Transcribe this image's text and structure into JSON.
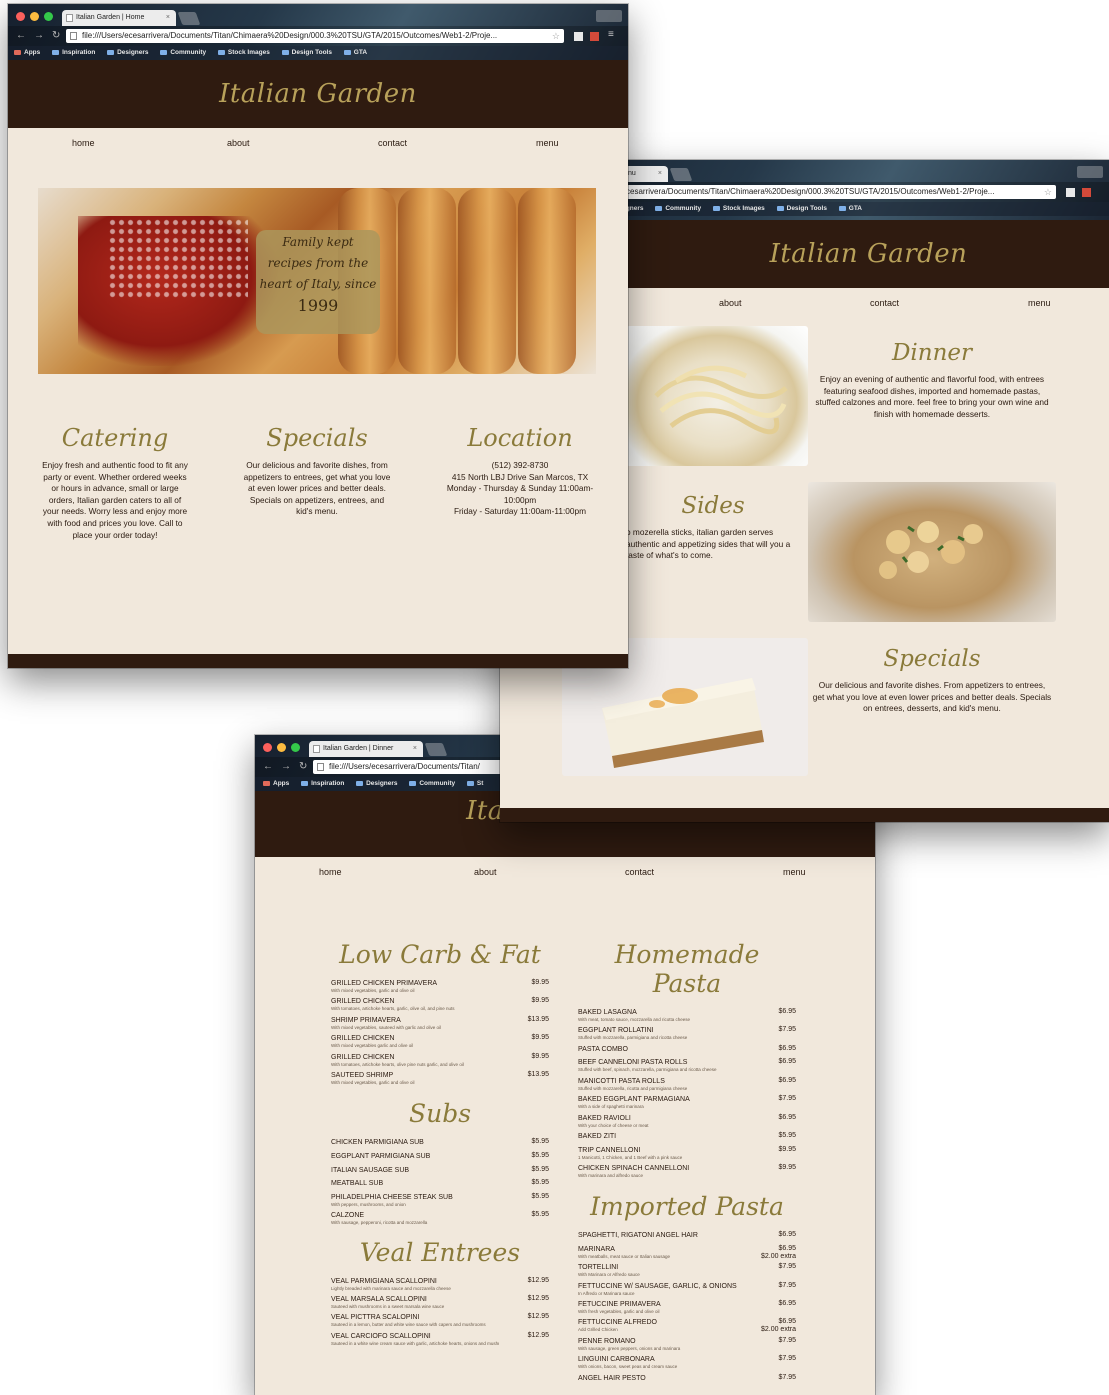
{
  "brand": {
    "logo": "Italian Garden",
    "header_bg": "#2f1b10",
    "accent": "#8a7a3a",
    "page_bg": "#f1e8dc"
  },
  "nav": {
    "home": "home",
    "about": "about",
    "contact": "contact",
    "menu": "menu"
  },
  "bookmarks": [
    "Apps",
    "Inspiration",
    "Designers",
    "Community",
    "Stock Images",
    "Design Tools",
    "GTA"
  ],
  "home_window": {
    "tab_title": "Italian Garden | Home",
    "url": "file:///Users/ecesarrivera/Documents/Titan/Chimaera%20Design/000.3%20TSU/GTA/2015/Outcomes/Web1-2/Proje...",
    "hero_badge": [
      "Family kept",
      "recipes from the",
      "heart of Italy, since",
      "1999"
    ],
    "catering": {
      "title": "Catering",
      "text": "Enjoy fresh and authentic food to fit any party or event. Whether ordered weeks or hours in advance, small or large orders, Italian garden caters to all of your needs. Worry less and enjoy more with food and prices you love. Call to place your order today!"
    },
    "specials": {
      "title": "Specials",
      "text": "Our delicious and favorite dishes, from appetizers to entrees, get what you love at even lower prices and better deals. Specials on appetizers, entrees, and kid's menu."
    },
    "location": {
      "title": "Location",
      "phone": "(512) 392-8730",
      "address": "415 North LBJ Drive San Marcos, TX",
      "hours1": "Monday - Thursday & Sunday 11:00am-10:00pm",
      "hours2": "Friday - Saturday 11:00am-11:00pm"
    }
  },
  "dinner_window": {
    "tab_title": "nu",
    "url": "cesarrivera/Documents/Titan/Chimaera%20Design/000.3%20TSU/GTA/2015/Outcomes/Web1-2/Proje...",
    "bookmarks": [
      "igners",
      "Community",
      "Stock Images",
      "Design Tools",
      "GTA"
    ],
    "dinner": {
      "title": "Dinner",
      "text": "Enjoy an evening of authentic and flavorful food, with entrees featuring seafood dishes, imported and homemade pastas, stuffed calzones and more. feel free to bring your own wine and finish with homemade desserts."
    },
    "sides": {
      "title": "Sides",
      "text": "o mozerella sticks, italian garden serves authentic and appetizing sides that will you a taste of what's to come."
    },
    "specials": {
      "title": "Specials",
      "text": "Our delicious and favorite dishes. From appetizers to entrees, get what you love at even lower prices and better deals. Specials on entrees, desserts, and kid's menu."
    }
  },
  "menu_window": {
    "tab_title": "Italian Garden | Dinner",
    "url": "file:///Users/ecesarrivera/Documents/Titan/",
    "bookmarks": [
      "Apps",
      "Inspiration",
      "Designers",
      "Community",
      "St"
    ],
    "low_carb": {
      "title": "Low Carb & Fat",
      "items": [
        {
          "name": "Grilled Chicken Primavera",
          "desc": "With mixed vegetables, garlic and olive oil",
          "price": "$9.95"
        },
        {
          "name": "Grilled Chicken",
          "desc": "With tomatoes, artichoke hearts, garlic, olive oil, and pine nuts",
          "price": "$9.95"
        },
        {
          "name": "Shrimp Primavera",
          "desc": "With mixed vegetables, sauteed with garlic and olive oil",
          "price": "$13.95"
        },
        {
          "name": "Grilled Chicken",
          "desc": "With mixed vegetables garlic and olive oil",
          "price": "$9.95"
        },
        {
          "name": "Grilled Chicken",
          "desc": "With tomatoes, artichoke hearts, olive pine nuts garlic, and olive oil",
          "price": "$9.95"
        },
        {
          "name": "Sauteed Shrimp",
          "desc": "With mixed vegetables, garlic and olive oil",
          "price": "$13.95"
        }
      ]
    },
    "subs": {
      "title": "Subs",
      "items": [
        {
          "name": "Chicken Parmigiana Sub",
          "desc": "",
          "price": "$5.95"
        },
        {
          "name": "Eggplant Parmigiana Sub",
          "desc": "",
          "price": "$5.95"
        },
        {
          "name": "Italian Sausage Sub",
          "desc": "",
          "price": "$5.95"
        },
        {
          "name": "Meatball Sub",
          "desc": "",
          "price": "$5.95"
        },
        {
          "name": "Philadelphia Cheese Steak Sub",
          "desc": "With peppers, mushrooms, and onion",
          "price": "$5.95"
        },
        {
          "name": "Calzone",
          "desc": "With sausage, pepperoni, ricotta and mozzarella",
          "price": "$5.95"
        }
      ]
    },
    "veal": {
      "title": "Veal Entrees",
      "items": [
        {
          "name": "Veal Parmigiana Scallopini",
          "desc": "Lightly breaded with marinara sauce and mozzarella cheese",
          "price": "$12.95"
        },
        {
          "name": "Veal Marsala Scallopini",
          "desc": "Sauteed with mushrooms in a sweet marsala wine sauce",
          "price": "$12.95"
        },
        {
          "name": "Veal Picttra Scalopini",
          "desc": "Sauteed in a lemon, butter and white wine sauce with capers and mushrooms",
          "price": "$12.95"
        },
        {
          "name": "Veal Carciofo Scallopini",
          "desc": "Sauteed in a white wine cream sauce with garlic, artichoke hearts, onions and mushroom",
          "price": "$12.95"
        }
      ]
    },
    "homemade": {
      "title": "Homemade Pasta",
      "items": [
        {
          "name": "Baked Lasagna",
          "desc": "With meat, tomato sauce, mozzarella and ricotta cheese",
          "price": "$6.95"
        },
        {
          "name": "Eggplant Rollatini",
          "desc": "Stuffed with mozzarella, parmigiana and ricotta cheese",
          "price": "$7.95"
        },
        {
          "name": "Pasta Combo",
          "desc": "",
          "price": "$6.95"
        },
        {
          "name": "Beef Canneloni Pasta Rolls",
          "desc": "Stuffed with beef, spinach, mozzarella, parmigiana and ricotta cheese",
          "price": "$6.95"
        },
        {
          "name": "Manicotti Pasta Rolls",
          "desc": "Stuffed with mozzarella, ricotta and parmigiana cheese",
          "price": "$6.95"
        },
        {
          "name": "Baked Eggplant Parmagiana",
          "desc": "With a side of spaghetti marinara",
          "price": "$7.95"
        },
        {
          "name": "Baked Ravioli",
          "desc": "With your choice of cheese or meat",
          "price": "$6.95"
        },
        {
          "name": "Baked Ziti",
          "desc": "",
          "price": "$5.95"
        },
        {
          "name": "Trip Cannelloni",
          "desc": "1 Manicotti, 1 Chicken, and 1 Beef with a pink sauce",
          "price": "$9.95"
        },
        {
          "name": "Chicken Spinach Cannelloni",
          "desc": "With marinara and alfredo sauce",
          "price": "$9.95"
        }
      ]
    },
    "imported": {
      "title": "Imported Pasta",
      "items": [
        {
          "name": "Spaghetti, Rigatoni Angel Hair",
          "desc": "",
          "price": "$6.95",
          "extra": ""
        },
        {
          "name": "Marinara",
          "desc": "With meatballs, meat sauce or Italian sausage",
          "price": "$6.95",
          "extra": "$2.00 extra"
        },
        {
          "name": "Tortellini",
          "desc": "With Marinara or Alfredo sauce",
          "price": "$7.95",
          "extra": ""
        },
        {
          "name": "Fettuccine w/ Sausage, Garlic, & Onions",
          "desc": "In Alfredo or Marinara sauce",
          "price": "$7.95",
          "extra": ""
        },
        {
          "name": "Fetuccine Primavera",
          "desc": "With fresh vegetables, garlic and olive oil",
          "price": "$6.95",
          "extra": ""
        },
        {
          "name": "Fettuccine Alfredo",
          "desc": "Add Grilled Chicken",
          "price": "$6.95",
          "extra": "$2.00 extra"
        },
        {
          "name": "Penne Romano",
          "desc": "With sausage, green peppers, onions and marinara",
          "price": "$7.95",
          "extra": ""
        },
        {
          "name": "Linguini Carbonara",
          "desc": "With onions, bacon, sweet peas and cream sauce",
          "price": "$7.95",
          "extra": ""
        },
        {
          "name": "Angel Hair Pesto",
          "desc": "",
          "price": "$7.95",
          "extra": ""
        }
      ]
    }
  }
}
